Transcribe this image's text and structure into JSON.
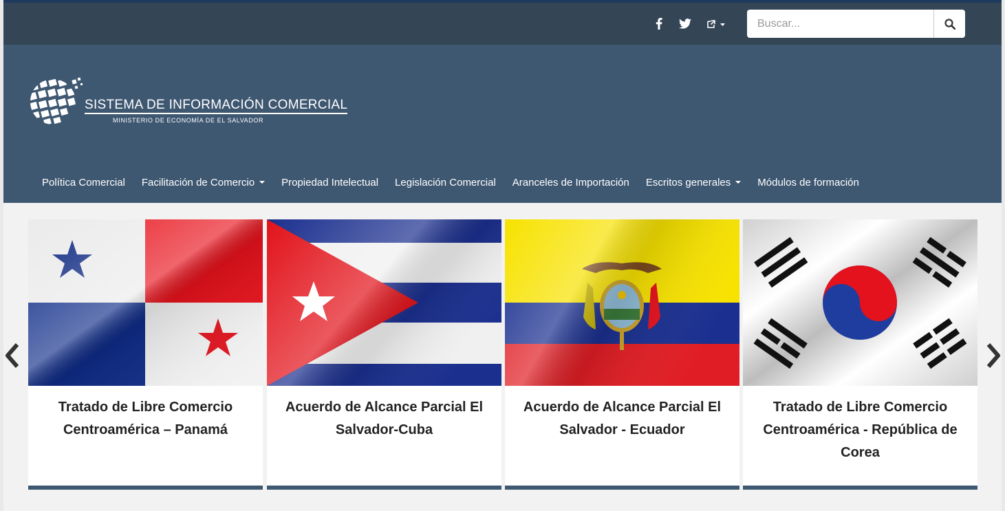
{
  "topbar": {
    "social": [
      {
        "name": "facebook-icon"
      },
      {
        "name": "twitter-icon"
      },
      {
        "name": "external-link-icon"
      }
    ],
    "search": {
      "placeholder": "Buscar..."
    }
  },
  "header": {
    "logo_title": "SISTEMA DE INFORMACIÓN COMERCIAL",
    "logo_subtitle": "MINISTERIO DE ECONOMÍA DE EL SALVADOR"
  },
  "nav": {
    "items": [
      {
        "label": "Política Comercial",
        "dropdown": false
      },
      {
        "label": "Facilitación de Comercio",
        "dropdown": true
      },
      {
        "label": "Propiedad Intelectual",
        "dropdown": false
      },
      {
        "label": "Legislación Comercial",
        "dropdown": false
      },
      {
        "label": "Aranceles de Importación",
        "dropdown": false
      },
      {
        "label": "Escritos generales",
        "dropdown": true
      },
      {
        "label": "Módulos de formación",
        "dropdown": false
      }
    ]
  },
  "carousel": {
    "cards": [
      {
        "title": "Tratado de Libre Comercio Centroamérica – Panamá",
        "flag": "panama-flag"
      },
      {
        "title": "Acuerdo de Alcance Parcial El Salvador-Cuba",
        "flag": "cuba-flag"
      },
      {
        "title": "Acuerdo de Alcance Parcial El Salvador - Ecuador",
        "flag": "ecuador-flag"
      },
      {
        "title": "Tratado de Libre Comercio Centroamérica - República de Corea",
        "flag": "korea-flag"
      }
    ]
  },
  "colors": {
    "topbar": "#344556",
    "header": "#3f5872",
    "page_background": "#f2f2f2",
    "card_border": "#3f5872"
  }
}
